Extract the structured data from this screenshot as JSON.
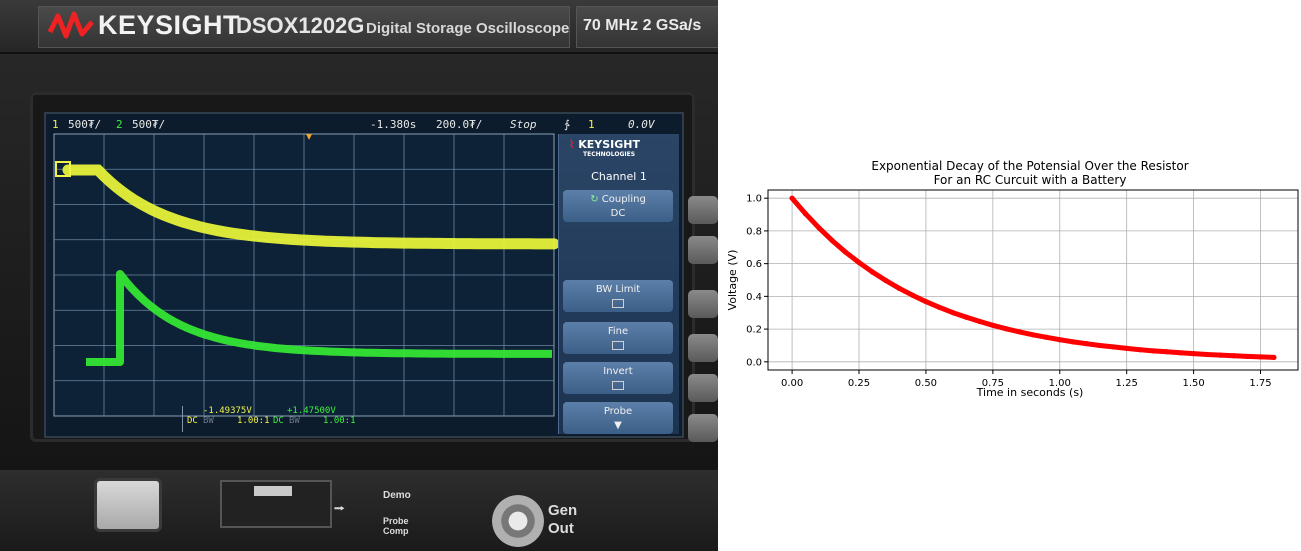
{
  "scope_photo": {
    "brand": "KEYSIGHT",
    "model": "DSOX1202G",
    "subtitle": "Digital Storage Oscilloscope",
    "spec": "70 MHz  2 GSa/s",
    "status_bar": {
      "ch1_num": "1",
      "ch1_scale": "500₮/",
      "ch2_num": "2",
      "ch2_scale": "500₮/",
      "time_offset": "-1.380s",
      "timebase": "200.0₮/",
      "run_state": "Stop",
      "trigger_symbol": "∱",
      "trigger_channel": "1",
      "trigger_level": "0.0V"
    },
    "menu": {
      "logo_text": "KEYSIGHT",
      "logo_sub": "TECHNOLOGIES",
      "title": "Channel 1",
      "coupling_label": "Coupling",
      "coupling_value": "DC",
      "bw_limit": "BW Limit",
      "fine": "Fine",
      "invert": "Invert",
      "probe": "Probe"
    },
    "readout": {
      "ch1_coupling": "DC",
      "ch1_bw": "BW",
      "ch1_value": "-1.49375V",
      "ch1_ratio": "1.00:1",
      "ch2_coupling": "DC",
      "ch2_bw": "BW",
      "ch2_value": "+1.47500V",
      "ch2_ratio": "1.00:1"
    },
    "front_panel": {
      "demo": "Demo",
      "probe_comp": "Probe Comp",
      "gen": "Gen",
      "out": "Out"
    }
  },
  "chart_data": {
    "type": "scatter",
    "title": "Exponential Decay of the Potensial Over the Resistor\nFor an RC Curcuit with a Battery",
    "title_lines": [
      "Exponential Decay of the Potensial Over the Resistor",
      "For an RC Curcuit with a Battery"
    ],
    "xlabel": "Time in seconds (s)",
    "ylabel": "Voltage (V)",
    "xlim": [
      -0.09,
      1.89
    ],
    "ylim": [
      -0.05,
      1.05
    ],
    "xticks": [
      0.0,
      0.25,
      0.5,
      0.75,
      1.0,
      1.25,
      1.5,
      1.75
    ],
    "xtick_labels": [
      "0.00",
      "0.25",
      "0.50",
      "0.75",
      "1.00",
      "1.25",
      "1.50",
      "1.75"
    ],
    "yticks": [
      0.0,
      0.2,
      0.4,
      0.6,
      0.8,
      1.0
    ],
    "ytick_labels": [
      "0.0",
      "0.2",
      "0.4",
      "0.6",
      "0.8",
      "1.0"
    ],
    "grid": true,
    "series": [
      {
        "color": "#ff0000",
        "x": [
          0.0,
          0.05,
          0.1,
          0.15,
          0.2,
          0.25,
          0.3,
          0.35,
          0.4,
          0.45,
          0.5,
          0.55,
          0.6,
          0.65,
          0.7,
          0.75,
          0.8,
          0.85,
          0.9,
          0.95,
          1.0,
          1.05,
          1.1,
          1.15,
          1.2,
          1.25,
          1.3,
          1.35,
          1.4,
          1.45,
          1.5,
          1.55,
          1.6,
          1.65,
          1.7,
          1.75,
          1.8
        ],
        "y": [
          1.0,
          0.905,
          0.819,
          0.741,
          0.67,
          0.607,
          0.549,
          0.497,
          0.449,
          0.407,
          0.368,
          0.333,
          0.301,
          0.273,
          0.247,
          0.223,
          0.202,
          0.183,
          0.165,
          0.15,
          0.135,
          0.122,
          0.111,
          0.1,
          0.091,
          0.082,
          0.074,
          0.067,
          0.061,
          0.055,
          0.05,
          0.045,
          0.041,
          0.037,
          0.033,
          0.03,
          0.027
        ]
      }
    ]
  }
}
